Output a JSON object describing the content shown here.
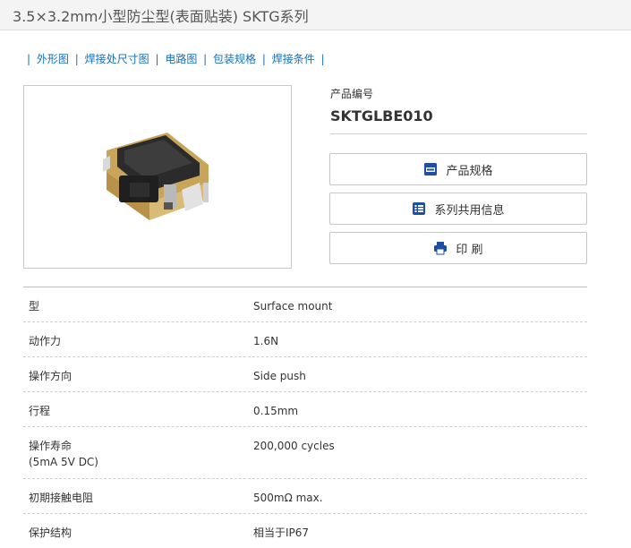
{
  "header": {
    "title": "3.5×3.2mm小型防尘型(表面贴装) SKTG系列"
  },
  "nav_links": [
    {
      "label": "外形图"
    },
    {
      "label": "焊接处尺寸图"
    },
    {
      "label": "电路图"
    },
    {
      "label": "包装规格"
    },
    {
      "label": "焊接条件"
    }
  ],
  "nav_separator": "|",
  "product": {
    "number_label": "产品编号",
    "number": "SKTGLBE010"
  },
  "actions": {
    "spec_label": "产品规格",
    "series_label": "系列共用信息",
    "print_label": "印 刷"
  },
  "colors": {
    "link": "#1a6fb5",
    "icon_blue": "#1f4fa3"
  },
  "specs": [
    {
      "key": "型",
      "value": "Surface mount"
    },
    {
      "key": "动作力",
      "value": "1.6N"
    },
    {
      "key": "操作方向",
      "value": "Side push"
    },
    {
      "key": "行程",
      "value": "0.15mm"
    },
    {
      "key": "操作寿命",
      "key2": "(5mA 5V DC)",
      "value": "200,000 cycles"
    },
    {
      "key": "初期接触电阻",
      "value": "500mΩ max."
    },
    {
      "key": "保护结构",
      "value": "相当于IP67"
    }
  ]
}
